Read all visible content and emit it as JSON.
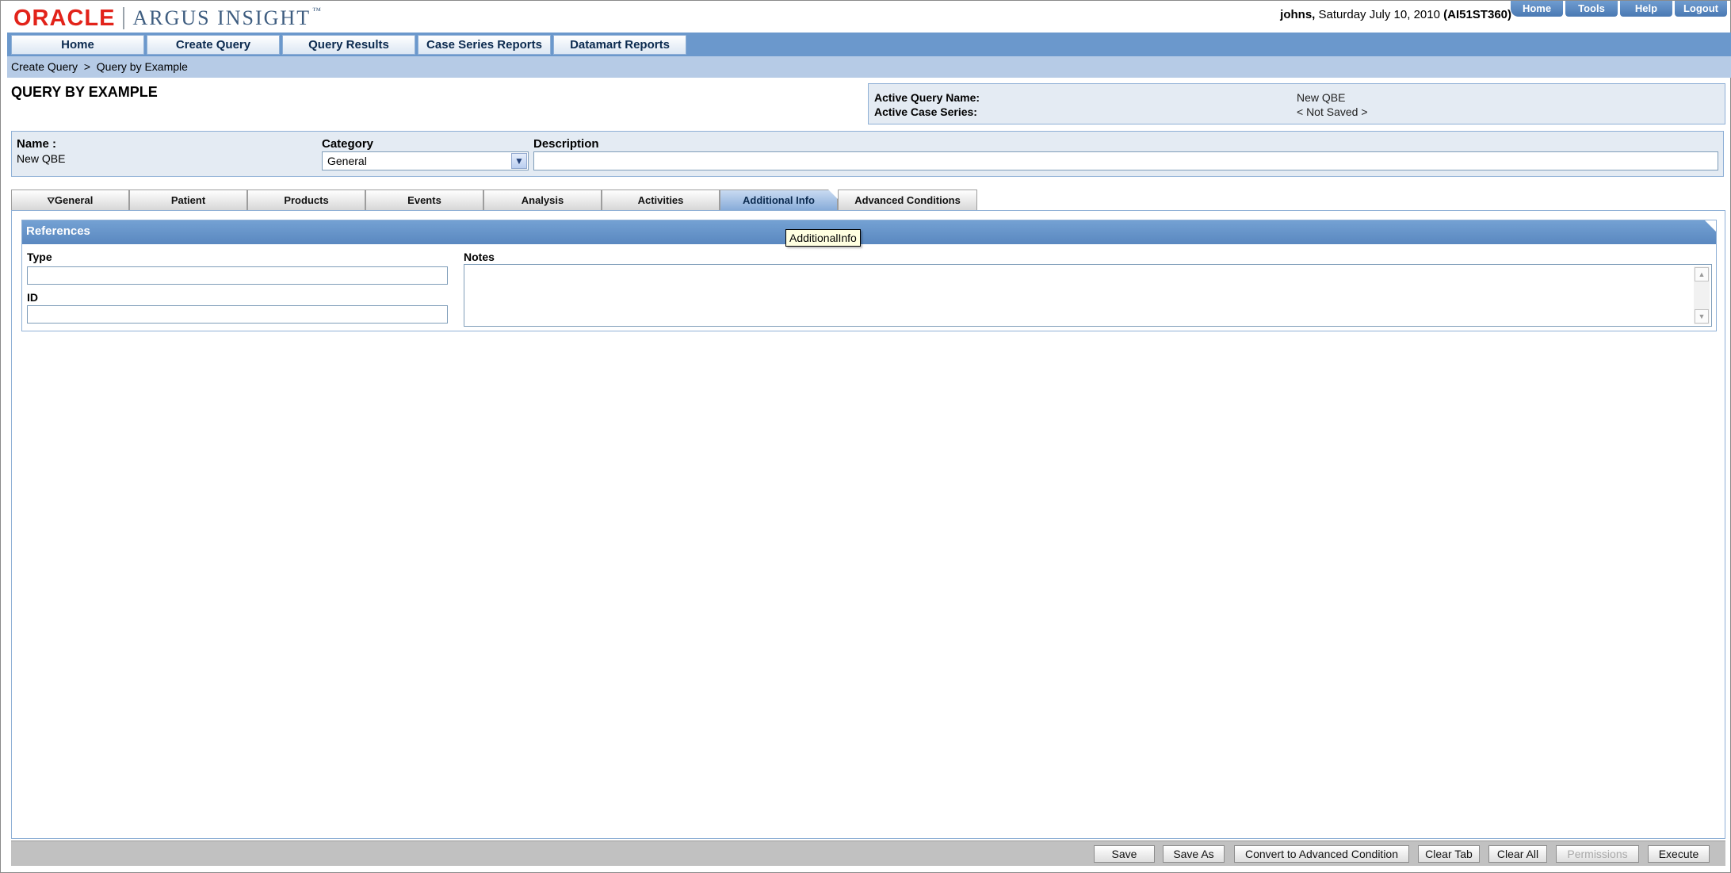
{
  "brand": {
    "oracle": "ORACLE",
    "product": "ARGUS INSIGHT",
    "tm": "™"
  },
  "user": {
    "name": "johns,",
    "date": "Saturday July 10, 2010",
    "server": "(AI51ST360)"
  },
  "top_links": [
    "Home",
    "Tools",
    "Help",
    "Logout"
  ],
  "nav": [
    "Home",
    "Create Query",
    "Query Results",
    "Case Series Reports",
    "Datamart Reports"
  ],
  "breadcrumb": "Create Query  >  Query by Example",
  "page_title": "QUERY BY EXAMPLE",
  "active": {
    "query_label": "Active Query Name:",
    "query_value": "New QBE",
    "series_label": "Active Case Series:",
    "series_value": "< Not Saved >"
  },
  "form": {
    "name_label": "Name :",
    "name_value": "New QBE",
    "category_label": "Category",
    "category_value": "General",
    "description_label": "Description",
    "description_value": ""
  },
  "tabs": [
    "General",
    "Patient",
    "Products",
    "Events",
    "Analysis",
    "Activities",
    "Additional Info",
    "Advanced Conditions"
  ],
  "active_tab": "Additional Info",
  "section": {
    "title": "References",
    "type_label": "Type",
    "id_label": "ID",
    "notes_label": "Notes"
  },
  "tooltip": "AdditionalInfo",
  "footer_buttons": [
    "Save",
    "Save As",
    "Convert to Advanced Condition",
    "Clear Tab",
    "Clear All",
    "Permissions",
    "Execute"
  ],
  "colors": {
    "nav": "#6b98cc",
    "brand_red": "#e2231a",
    "panel_border": "#8fb0d6"
  }
}
